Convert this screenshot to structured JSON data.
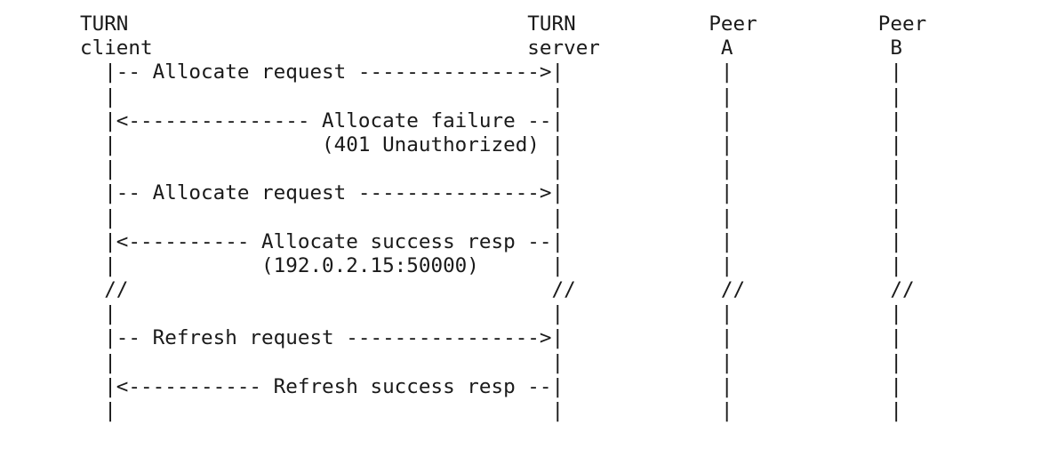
{
  "diagram": {
    "lines": [
      "TURN                                 TURN           Peer          Peer",
      "client                               server          A             B",
      "  |-- Allocate request --------------->|             |             |",
      "  |                                    |             |             |",
      "  |<--------------- Allocate failure --|             |             |",
      "  |                 (401 Unauthorized) |             |             |",
      "  |                                    |             |             |",
      "  |-- Allocate request --------------->|             |             |",
      "  |                                    |             |             |",
      "  |<---------- Allocate success resp --|             |             |",
      "  |            (192.0.2.15:50000)      |             |             |",
      "  //                                   //            //            //",
      "  |                                    |             |             |",
      "  |-- Refresh request ---------------->|             |             |",
      "  |                                    |             |             |",
      "  |<----------- Refresh success resp --|             |             |",
      "  |                                    |             |             |"
    ]
  }
}
